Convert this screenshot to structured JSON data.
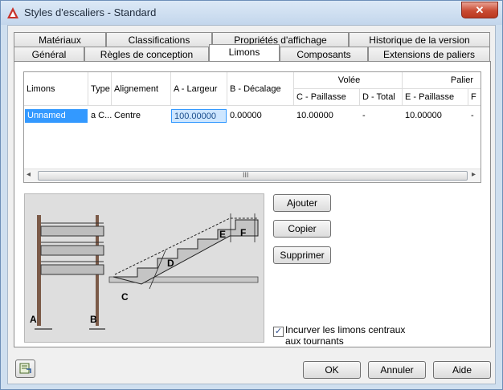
{
  "window": {
    "title": "Styles d'escaliers - Standard",
    "close_glyph": "✕"
  },
  "tabs_row1": [
    "Matériaux",
    "Classifications",
    "Propriétés d'affichage",
    "Historique de la version"
  ],
  "tabs_row2": [
    "Général",
    "Règles de conception",
    "Limons",
    "Composants",
    "Extensions de paliers"
  ],
  "active_tab": "Limons",
  "grid": {
    "headers": {
      "limons": "Limons",
      "type": "Type",
      "alignement": "Alignement",
      "a_largeur": "A - Largeur",
      "b_decalage": "B - Décalage",
      "volee": "Volée",
      "palier": "Palier",
      "c_paillasse": "C - Paillasse",
      "d_total": "D - Total",
      "e_paillasse": "E - Paillasse",
      "f": "F"
    },
    "row": {
      "limons": "Unnamed",
      "type": "a C...",
      "alignement": "Centre",
      "a_largeur": "100.00000",
      "b_decalage": "0.00000",
      "c_paillasse": "10.00000",
      "d_total": "-",
      "e_paillasse": "10.00000",
      "f": "-"
    },
    "scroll_thumb": "III",
    "scroll_left": "◂",
    "scroll_right": "▸"
  },
  "buttons": {
    "ajouter": "Ajouter",
    "copier": "Copier",
    "supprimer": "Supprimer",
    "ok": "OK",
    "annuler": "Annuler",
    "aide": "Aide"
  },
  "checkbox": {
    "label": "Incurver les limons centraux aux tournants",
    "checked": true,
    "glyph": "✓"
  },
  "diagram_labels": {
    "a": "A",
    "b": "B",
    "c": "C",
    "d": "D",
    "e": "E",
    "f": "F"
  }
}
